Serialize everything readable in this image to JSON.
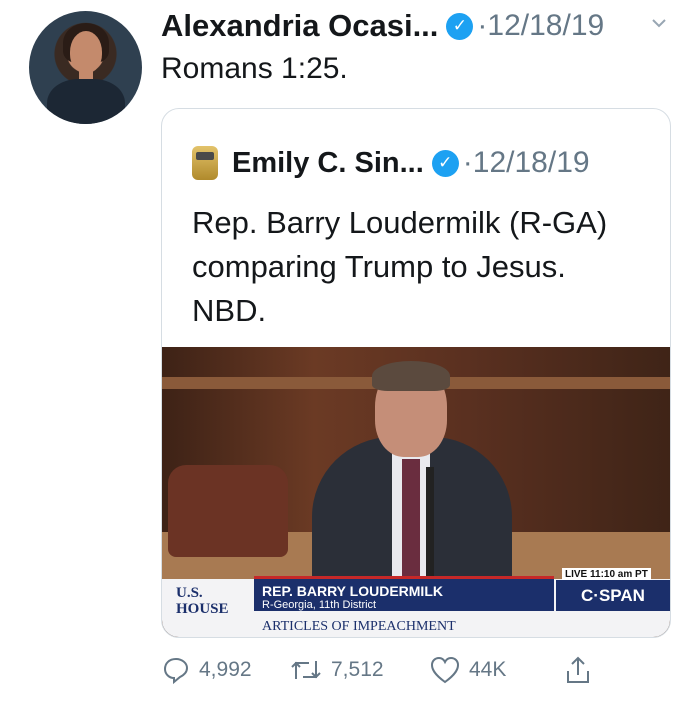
{
  "tweet": {
    "author": "Alexandria Ocasi...",
    "verified": true,
    "separator": "·",
    "date": "12/18/19",
    "text": "Romans 1:25."
  },
  "quote": {
    "author": "Emily C. Sin...",
    "verified": true,
    "separator": "·",
    "date": "12/18/19",
    "text_lines": [
      "Rep. Barry Loudermilk (R-GA)",
      "comparing Trump to Jesus.",
      "NBD."
    ],
    "video": {
      "house_line1": "U.S.",
      "house_line2": "HOUSE",
      "speaker": "REP. BARRY LOUDERMILK",
      "district": "R-Georgia, 11th District",
      "topic": "ARTICLES OF IMPEACHMENT",
      "live": "LIVE  11:10 am PT",
      "network": "C·SPAN"
    }
  },
  "actions": {
    "replies": "4,992",
    "retweets": "7,512",
    "likes": "44K"
  },
  "colors": {
    "accent": "#1da1f2",
    "muted": "#657786",
    "cspan_blue": "#1b2f6b"
  },
  "icons": [
    "verified-icon",
    "chevron-down-icon",
    "reply-icon",
    "retweet-icon",
    "like-icon",
    "share-icon"
  ]
}
